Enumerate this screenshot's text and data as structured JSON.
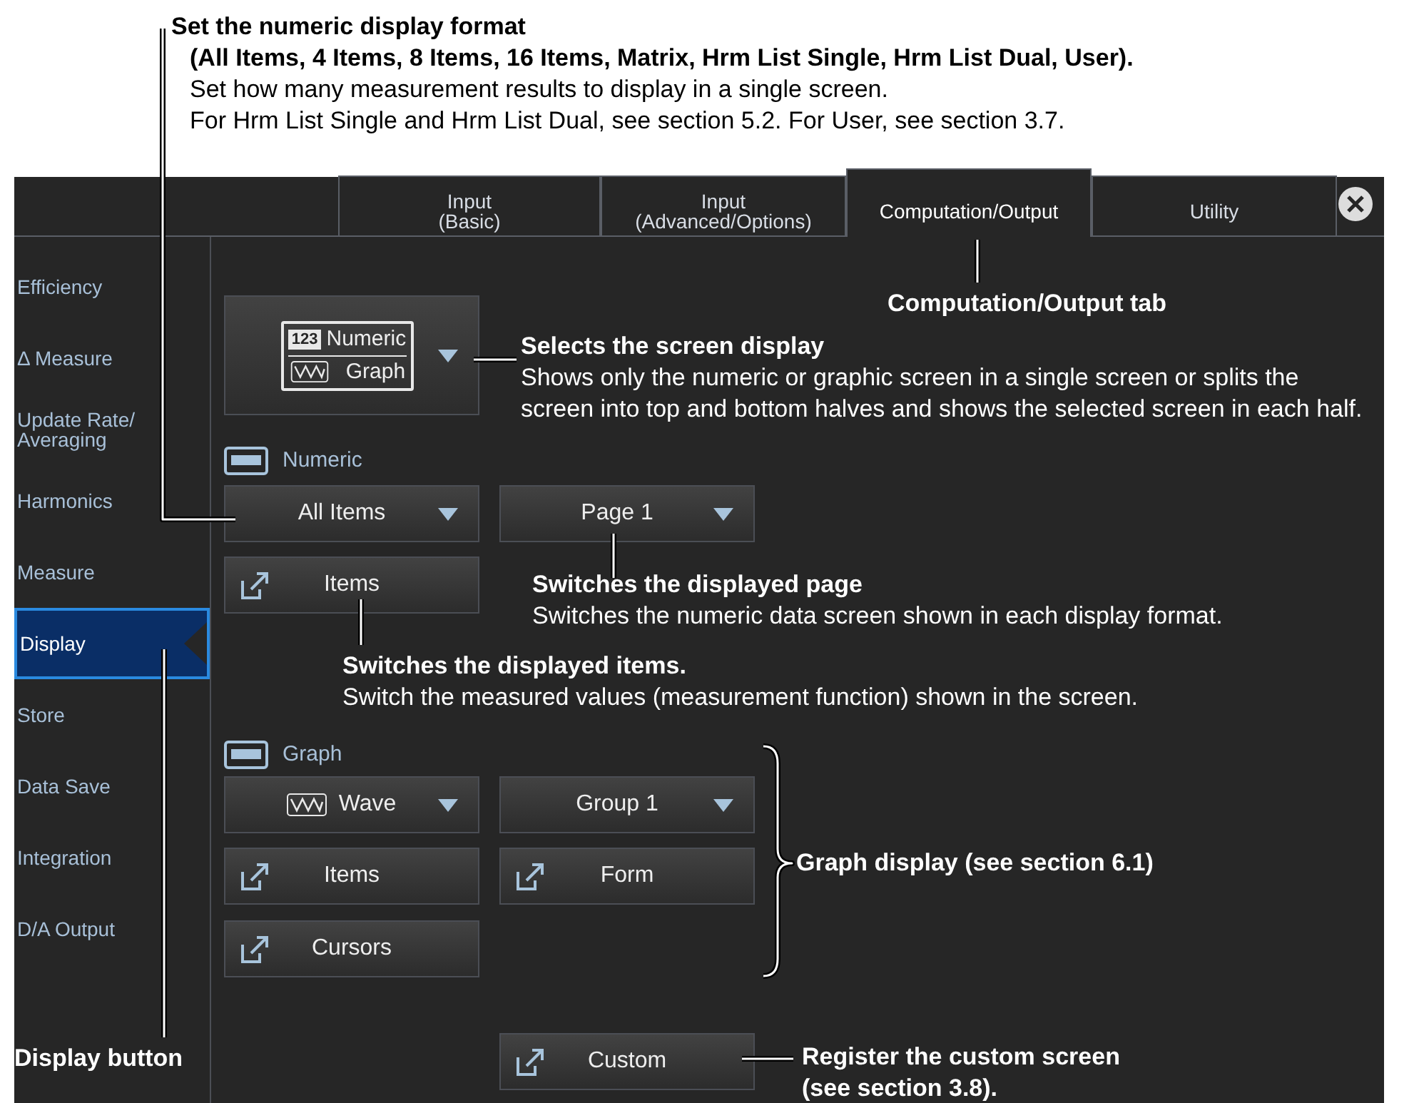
{
  "header_annotation": {
    "title": "Set the numeric display format",
    "options": "(All Items, 4 Items, 8 Items, 16 Items, Matrix, Hrm List Single, Hrm List Dual, User).",
    "lines": [
      "Set how many measurement results to display in a single screen.",
      "For Hrm List Single and Hrm List Dual, see section 5.2. For User, see section 3.7."
    ]
  },
  "tabs": [
    {
      "label": "Input\n(Basic)",
      "selected": false
    },
    {
      "label": "Input\n(Advanced/Options)",
      "selected": false
    },
    {
      "label": "Computation/Output",
      "selected": true
    },
    {
      "label": "Utility",
      "selected": false
    }
  ],
  "sidebar": {
    "items": [
      {
        "label": "Efficiency",
        "selected": false
      },
      {
        "label": "Δ Measure",
        "selected": false
      },
      {
        "label": "Update Rate/\nAveraging",
        "selected": false
      },
      {
        "label": "Harmonics",
        "selected": false
      },
      {
        "label": "Measure",
        "selected": false
      },
      {
        "label": "Display",
        "selected": true
      },
      {
        "label": "Store",
        "selected": false
      },
      {
        "label": "Data Save",
        "selected": false
      },
      {
        "label": "Integration",
        "selected": false
      },
      {
        "label": "D/A Output",
        "selected": false
      }
    ]
  },
  "screen_selector": {
    "badge": "123",
    "numeric": "Numeric",
    "graph": "Graph"
  },
  "numeric": {
    "label": "Numeric",
    "format": "All Items",
    "page": "Page 1",
    "items_button": "Items"
  },
  "graph": {
    "label": "Graph",
    "type": "Wave",
    "group": "Group 1",
    "items_button": "Items",
    "form_button": "Form",
    "cursors_button": "Cursors"
  },
  "custom_button": "Custom",
  "annotations": [
    {
      "kind": "tab",
      "title": "Computation/Output tab"
    },
    {
      "kind": "selector",
      "title": "Selects the screen display",
      "body": "Shows only the numeric or graphic screen in a single screen or splits the screen into top and bottom halves and shows the selected screen in each half."
    },
    {
      "kind": "page",
      "title": "Switches the displayed page",
      "body": "Switches the numeric data screen shown in each display format."
    },
    {
      "kind": "items",
      "title": "Switches the displayed items.",
      "body": "Switch the measured values (measurement function) shown in the screen."
    },
    {
      "kind": "graph",
      "title": "Graph display (see section 6.1)"
    },
    {
      "kind": "display",
      "title": "Display button"
    },
    {
      "kind": "custom",
      "title": "Register the custom screen\n(see section 3.8)."
    }
  ]
}
